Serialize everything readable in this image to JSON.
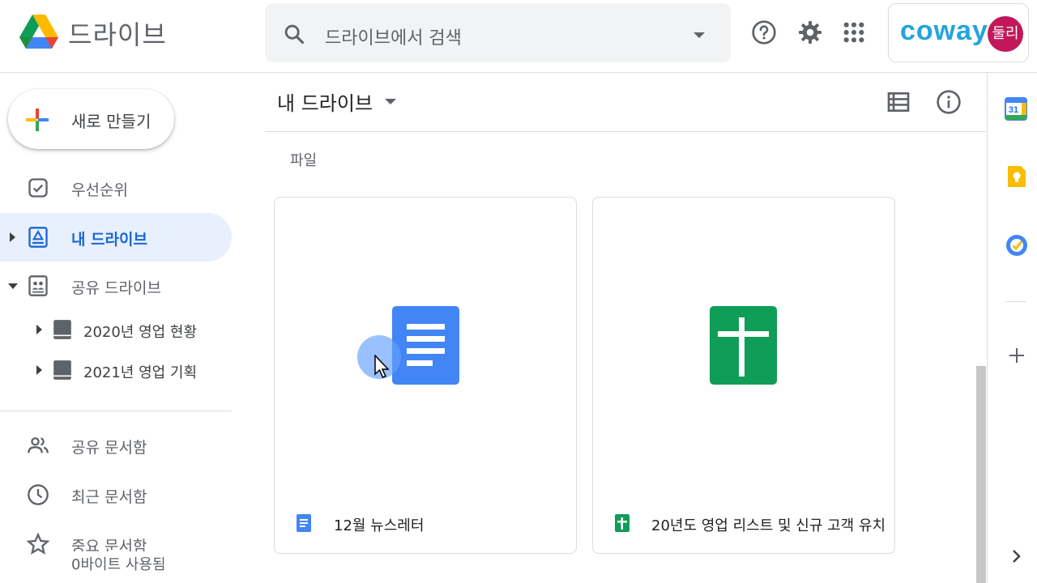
{
  "header": {
    "app_name": "드라이브",
    "search_placeholder": "드라이브에서 검색",
    "brand": "coway",
    "avatar_text": "둘리",
    "icons": [
      "drive-logo-icon",
      "search-icon",
      "help-icon",
      "settings-icon",
      "apps-grid-icon"
    ]
  },
  "sidebar": {
    "new_button": "새로 만들기",
    "items": [
      {
        "label": "우선순위",
        "icon": "priority-check-icon"
      },
      {
        "label": "내 드라이브",
        "icon": "my-drive-icon",
        "active": true
      },
      {
        "label": "공유 드라이브",
        "icon": "shared-drive-icon"
      },
      {
        "label": "공유 문서함",
        "icon": "people-icon"
      },
      {
        "label": "최근 문서함",
        "icon": "clock-icon"
      },
      {
        "label": "중요 문서함",
        "icon": "star-icon"
      }
    ],
    "shared_drives": [
      {
        "label": "2020년 영업 현황"
      },
      {
        "label": "2021년 영업 기획"
      }
    ],
    "storage": "0바이트 사용됨"
  },
  "main": {
    "title": "내 드라이브",
    "section": "파일",
    "files": [
      {
        "name": "12월 뉴스레터",
        "type": "docs",
        "color": "#4285f4"
      },
      {
        "name": "20년도 영업 리스트 및 신규 고객 유치",
        "type": "sheets",
        "color": "#0f9d58"
      }
    ]
  },
  "rail": {
    "calendar_day": "31",
    "icons": [
      "calendar-icon",
      "keep-icon",
      "tasks-icon",
      "add-icon",
      "expand-icon"
    ]
  },
  "colors": {
    "accent": "#1967d2",
    "active_bg": "#e8f0fe",
    "brand": "#23a4dd",
    "avatar": "#c2185b"
  }
}
